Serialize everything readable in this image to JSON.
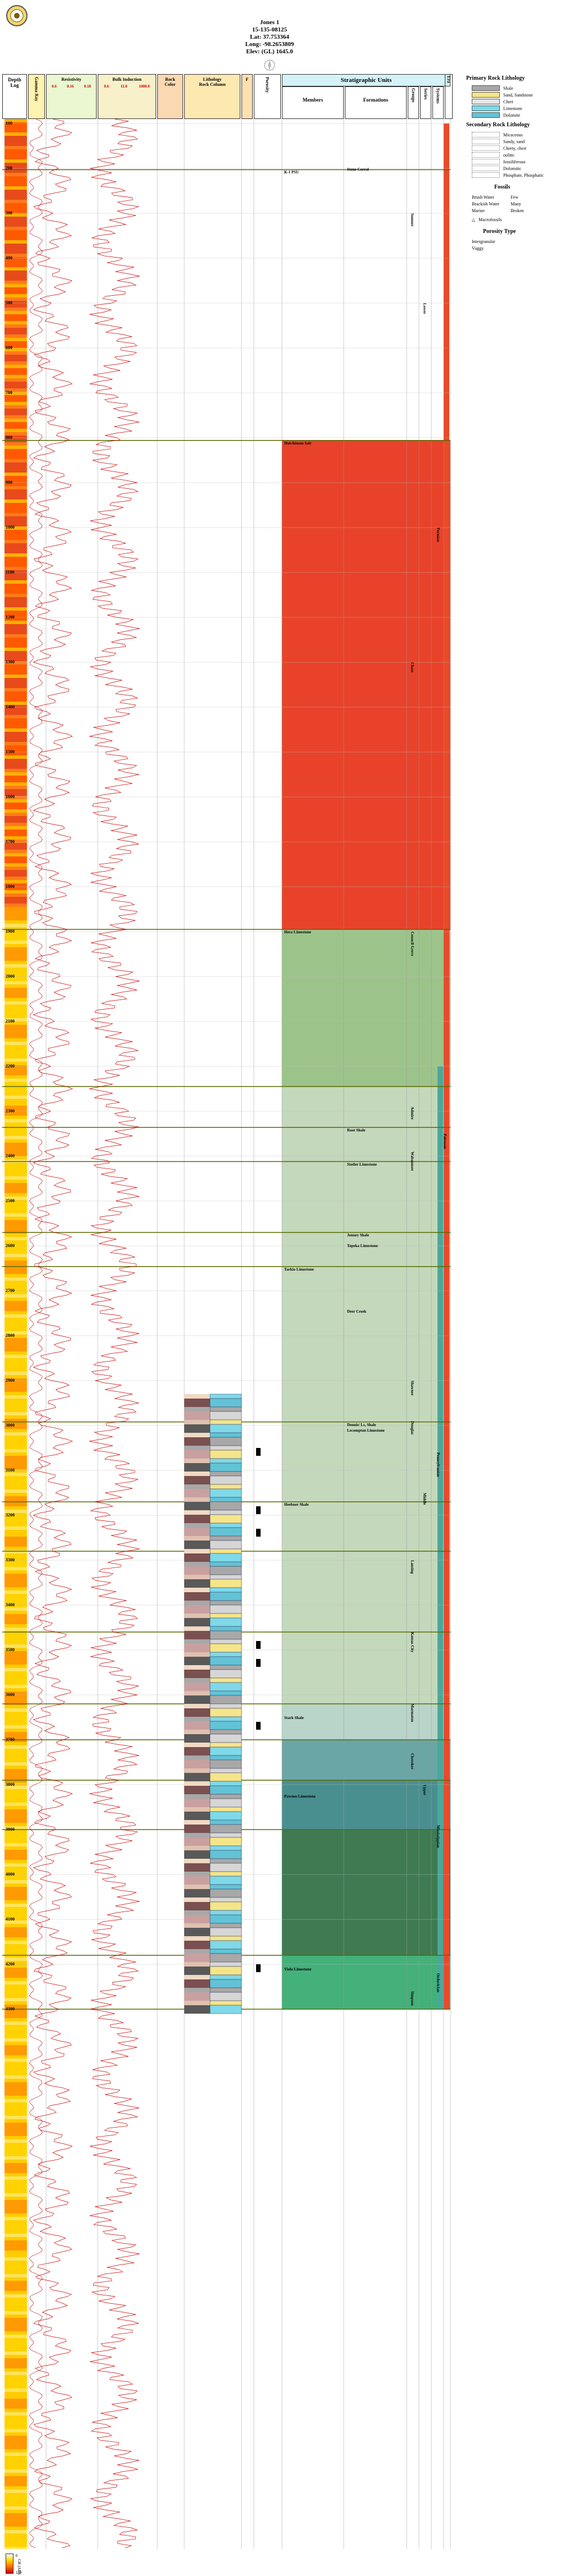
{
  "header": {
    "well_name": "Jones 1",
    "api": "15-135-08125",
    "lat": "Lat: 37.753364",
    "long": "Long: -98.2653809",
    "elev": "Elev: (GL) 1645.0",
    "logo_icon": "kgs-seal-icon",
    "north_icon": "compass-icon"
  },
  "columns": {
    "depth": "Depth",
    "log": "Log",
    "gr": "Gamma Ray",
    "resistivity": "Resistivity",
    "res_scale": [
      "0.6",
      "0.16",
      "0.18"
    ],
    "bulk_induction": "Bulk Induction",
    "bulk_scale": [
      "0.6",
      "11.0",
      "1000.0"
    ],
    "rock": "Rock",
    "rock_sub": "Color",
    "lithology": "Lithology",
    "lith_sub": "Rock Column",
    "fossils_head": "F",
    "porosity_head": "Porosity",
    "strat_units": "Stratigraphic Units",
    "members": "Members",
    "formations": "Formations",
    "groups": "Groups",
    "series": "Series",
    "systems": "Systems",
    "era": "Era"
  },
  "depths": [
    "100",
    "200",
    "300",
    "400",
    "500",
    "600",
    "700",
    "800",
    "900",
    "1000",
    "1100",
    "1200",
    "1300",
    "1400",
    "1500",
    "1600",
    "1700",
    "1800",
    "1900",
    "2000",
    "2100",
    "2200",
    "2300",
    "2400",
    "2500",
    "2600",
    "2700",
    "2800",
    "2900",
    "3000",
    "3100",
    "3200",
    "3300",
    "3400",
    "3500",
    "3600",
    "3700",
    "3800",
    "3900",
    "4000",
    "4100",
    "4200",
    "4300"
  ],
  "members": [
    {
      "label": "K-1 PSU",
      "top": 203
    },
    {
      "label": "Hutchinson Salt",
      "top": 806
    },
    {
      "label": "Hera Limestone",
      "top": 1895
    },
    {
      "label": "Tarkio Limestone",
      "top": 2646
    },
    {
      "label": "Heebner Shale",
      "top": 3170
    },
    {
      "label": "Stark Shale",
      "top": 3645
    },
    {
      "label": "Pawnee Limestone",
      "top": 3820
    },
    {
      "label": "Viola Limestone",
      "top": 4205
    }
  ],
  "formations": [
    {
      "label": "Stone Corral",
      "top": 196
    },
    {
      "label": "Root Shale",
      "top": 2336
    },
    {
      "label": "Stotler Limestone",
      "top": 2412
    },
    {
      "label": "Jenney Shale",
      "top": 2570
    },
    {
      "label": "Topeka Limestone",
      "top": 2594
    },
    {
      "label": "Deer Creek",
      "top": 2740
    },
    {
      "label": "Dennis/ Ls, Shale",
      "top": 2992
    },
    {
      "label": "Lecompton Limestone",
      "top": 3005
    }
  ],
  "groups": [
    "Sumner",
    "Chase",
    "Council Grove",
    "Admire",
    "Wabaunsee",
    "Shawnee",
    "Douglas",
    "Lansing",
    "Kansas City",
    "Marmaton",
    "Cherokee",
    "Simpson"
  ],
  "systems": [
    "Permian",
    "Pennsylvanian",
    "Mississippian",
    "Ordovician"
  ],
  "series": [
    "Lower",
    "Middle",
    "Upper"
  ],
  "era": [
    "Paleozoic"
  ],
  "legend": {
    "primary_title": "Primary Rock Lithology",
    "primary": [
      {
        "label": "Shale",
        "color": "#a8a8a8"
      },
      {
        "label": "Sand, Sandstone",
        "color": "#f5e58a"
      },
      {
        "label": "Chert",
        "color": "#e6e6e6"
      },
      {
        "label": "Limestone",
        "color": "#7fd9e8"
      },
      {
        "label": "Dolomite",
        "color": "#63c3d6"
      }
    ],
    "secondary_title": "Secondary Rock Lithology",
    "secondary": [
      "Micaceous",
      "Sandy, sand",
      "Cherty, chert",
      "oolitic",
      "fossiliferous",
      "Dolomitic",
      "Phosphate, Phosphatic"
    ],
    "fossil_title": "Fossils",
    "fossils_left": [
      "Brush Water",
      "Brackish Water",
      "Marine"
    ],
    "fossils_right": [
      "Few",
      "Many",
      "Broken"
    ],
    "macro": "Macrofossils",
    "porosity_title": "Porosity Type",
    "porosity": [
      "Intergranular",
      "Vuggy"
    ]
  },
  "scale_bar": {
    "label": "GR (API)",
    "min": "0",
    "max": "150"
  }
}
